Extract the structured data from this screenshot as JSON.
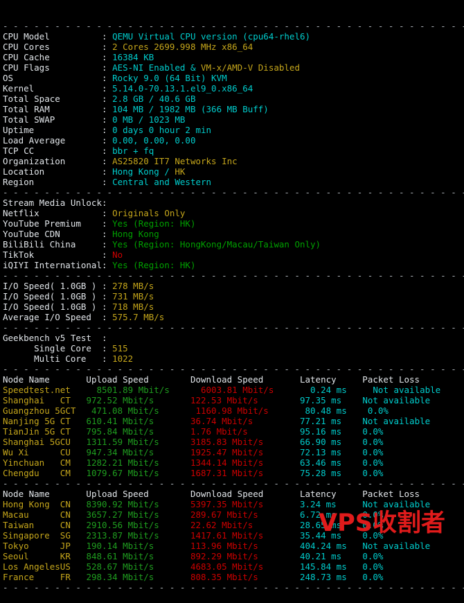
{
  "terminal": {
    "separator": "- - - - - - - - - - - - - - - - - - - - - - - - - - - - - - - - - - - - - - - - - - - - - - - -",
    "watermark": "VPS收割者"
  },
  "system_info": {
    "rows": [
      {
        "label": "CPU Model",
        "value": "QEMU Virtual CPU version (cpu64-rhel6)",
        "color": "cy"
      },
      {
        "label": "CPU Cores",
        "value": "2 Cores 2699.998 MHz x86_64",
        "color": "ye"
      },
      {
        "label": "CPU Cache",
        "value": "16384 KB",
        "color": "cy"
      },
      {
        "label": "CPU Flags",
        "value": "AES-NI Enabled & VM-x/AMD-V Disabled",
        "color": "split_flags"
      },
      {
        "label": "OS",
        "value": "Rocky 9.0 (64 Bit) KVM",
        "color": "cy"
      },
      {
        "label": "Kernel",
        "value": "5.14.0-70.13.1.el9_0.x86_64",
        "color": "cy"
      },
      {
        "label": "Total Space",
        "value": "2.8 GB / 40.6 GB",
        "color": "cy"
      },
      {
        "label": "Total RAM",
        "value": "104 MB / 1982 MB (366 MB Buff)",
        "color": "cy"
      },
      {
        "label": "Total SWAP",
        "value": "0 MB / 1023 MB",
        "color": "cy"
      },
      {
        "label": "Uptime",
        "value": "0 days 0 hour 2 min",
        "color": "cy"
      },
      {
        "label": "Load Average",
        "value": "0.00, 0.00, 0.00",
        "color": "cy"
      },
      {
        "label": "TCP CC",
        "value": "bbr + fq",
        "color": "cy"
      },
      {
        "label": "Organization",
        "value": "AS25820 IT7 Networks Inc",
        "color": "ye"
      },
      {
        "label": "Location",
        "value": "Hong Kong / HK",
        "color": "split_loc"
      },
      {
        "label": "Region",
        "value": "Central and Western",
        "color": "cy"
      }
    ],
    "flags_part1": "AES-NI Enabled & ",
    "flags_part2": "VM-x/AMD-V Disabled",
    "location_part1": "Hong Kong / ",
    "location_part2": "HK"
  },
  "stream_media": {
    "title": "Stream Media Unlock",
    "rows": [
      {
        "label": "Netflix",
        "value": "Originals Only",
        "color": "ye"
      },
      {
        "label": "YouTube Premium",
        "value": "Yes (Region: HK)",
        "color": "gr"
      },
      {
        "label": "YouTube CDN",
        "value": "Hong Kong",
        "color": "gr"
      },
      {
        "label": "BiliBili China",
        "value": "Yes (Region: HongKong/Macau/Taiwan Only)",
        "color": "gr"
      },
      {
        "label": "TikTok",
        "value": "No",
        "color": "rd"
      },
      {
        "label": "iQIYI International",
        "value": "Yes (Region: HK)",
        "color": "gr"
      }
    ]
  },
  "io_speed": {
    "rows": [
      {
        "label": "I/O Speed( 1.0GB )",
        "value": "278 MB/s",
        "color": "ye"
      },
      {
        "label": "I/O Speed( 1.0GB )",
        "value": "731 MB/s",
        "color": "ye"
      },
      {
        "label": "I/O Speed( 1.0GB )",
        "value": "718 MB/s",
        "color": "ye"
      },
      {
        "label": "Average I/O Speed",
        "value": "575.7 MB/s",
        "color": "ye"
      }
    ]
  },
  "geekbench": {
    "title": "Geekbench v5 Test",
    "rows": [
      {
        "label": "Single Core",
        "value": "515",
        "color": "ye"
      },
      {
        "label": "Multi Core",
        "value": "1022",
        "color": "ye"
      }
    ]
  },
  "speedtest_domestic": {
    "headers": [
      "Node Name",
      "Upload Speed",
      "Download Speed",
      "Latency",
      "Packet Loss"
    ],
    "rows": [
      {
        "node": "Speedtest.net",
        "isp": "",
        "upload": "8501.89 Mbit/s",
        "download": "6003.81 Mbit/s",
        "latency": "0.24 ms",
        "loss": "Not available"
      },
      {
        "node": "Shanghai",
        "isp": "CT",
        "upload": "972.52 Mbit/s",
        "download": "122.53 Mbit/s",
        "latency": "97.35 ms",
        "loss": "Not available"
      },
      {
        "node": "Guangzhou 5G",
        "isp": "CT",
        "upload": "471.08 Mbit/s",
        "download": "1160.98 Mbit/s",
        "latency": "80.48 ms",
        "loss": "0.0%"
      },
      {
        "node": "Nanjing 5G",
        "isp": "CT",
        "upload": "610.41 Mbit/s",
        "download": "36.74 Mbit/s",
        "latency": "77.21 ms",
        "loss": "Not available"
      },
      {
        "node": "TianJin 5G",
        "isp": "CT",
        "upload": "795.84 Mbit/s",
        "download": "1.76 Mbit/s",
        "latency": "95.16 ms",
        "loss": "0.0%"
      },
      {
        "node": "Shanghai 5G",
        "isp": "CU",
        "upload": "1311.59 Mbit/s",
        "download": "3185.83 Mbit/s",
        "latency": "66.90 ms",
        "loss": "0.0%"
      },
      {
        "node": "Wu Xi",
        "isp": "CU",
        "upload": "947.34 Mbit/s",
        "download": "1925.47 Mbit/s",
        "latency": "72.13 ms",
        "loss": "0.0%"
      },
      {
        "node": "Yinchuan",
        "isp": "CM",
        "upload": "1282.21 Mbit/s",
        "download": "1344.14 Mbit/s",
        "latency": "63.46 ms",
        "loss": "0.0%"
      },
      {
        "node": "Chengdu",
        "isp": "CM",
        "upload": "1079.67 Mbit/s",
        "download": "1687.31 Mbit/s",
        "latency": "75.28 ms",
        "loss": "0.0%"
      }
    ]
  },
  "speedtest_international": {
    "headers": [
      "Node Name",
      "Upload Speed",
      "Download Speed",
      "Latency",
      "Packet Loss"
    ],
    "rows": [
      {
        "node": "Hong Kong",
        "isp": "CN",
        "upload": "8390.92 Mbit/s",
        "download": "5397.35 Mbit/s",
        "latency": "3.24 ms",
        "loss": "Not available"
      },
      {
        "node": "Macau",
        "isp": "CN",
        "upload": "3657.27 Mbit/s",
        "download": "289.67 Mbit/s",
        "latency": "6.72 ms",
        "loss": "0.0%"
      },
      {
        "node": "Taiwan",
        "isp": "CN",
        "upload": "2910.56 Mbit/s",
        "download": "22.62 Mbit/s",
        "latency": "28.65 ms",
        "loss": "0.0%"
      },
      {
        "node": "Singapore",
        "isp": "SG",
        "upload": "2313.87 Mbit/s",
        "download": "1417.61 Mbit/s",
        "latency": "35.44 ms",
        "loss": "0.0%"
      },
      {
        "node": "Tokyo",
        "isp": "JP",
        "upload": "190.14 Mbit/s",
        "download": "113.96 Mbit/s",
        "latency": "404.24 ms",
        "loss": "Not available"
      },
      {
        "node": "Seoul",
        "isp": "KR",
        "upload": "848.61 Mbit/s",
        "download": "892.29 Mbit/s",
        "latency": "40.21 ms",
        "loss": "0.0%"
      },
      {
        "node": "Los Angeles",
        "isp": "US",
        "upload": "528.67 Mbit/s",
        "download": "4683.05 Mbit/s",
        "latency": "145.84 ms",
        "loss": "0.0%"
      },
      {
        "node": "France",
        "isp": "FR",
        "upload": "298.34 Mbit/s",
        "download": "808.35 Mbit/s",
        "latency": "248.73 ms",
        "loss": "0.0%"
      }
    ]
  },
  "colors": {
    "background": "#000000",
    "label": "#e2e6ea",
    "cyan": "#00cdcd",
    "yellow": "#c5a61b",
    "green": "#00a000",
    "red": "#cd0000",
    "watermark": "#e01b1b"
  }
}
